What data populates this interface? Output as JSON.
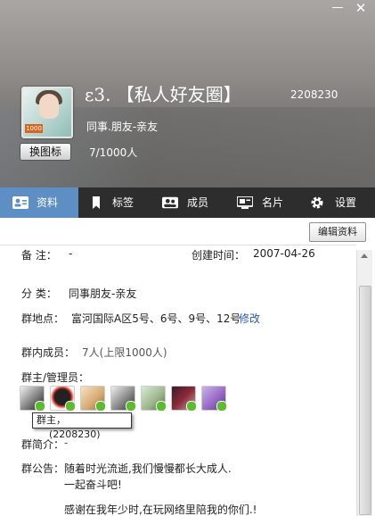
{
  "window": {
    "min_glyph": "—",
    "close_glyph": "✕"
  },
  "group": {
    "name": "ε3. 【私人好友圈】",
    "id": "2208230",
    "category": "同事.朋友-亲友",
    "member_count": "7/1000人",
    "avatar_badge": "1000",
    "change_icon_label": "换图标"
  },
  "tabs": [
    {
      "label": "资料",
      "icon": "id-card-icon"
    },
    {
      "label": "标签",
      "icon": "bookmark-icon"
    },
    {
      "label": "成员",
      "icon": "members-icon"
    },
    {
      "label": "名片",
      "icon": "business-card-icon"
    },
    {
      "label": "设置",
      "icon": "gear-icon"
    }
  ],
  "profile": {
    "edit_label": "编辑资料",
    "remark_label": "备  注：",
    "remark_value": "-",
    "created_label": "创建时间：",
    "created_value": "2007-04-26",
    "category_label": "分  类：",
    "category_value": "同事朋友-亲友",
    "location_label": "群地点：",
    "location_value": "富河国际A区5号、6号、9号、12号",
    "location_edit": "修改",
    "members_label": "群内成员：",
    "members_value": "7人(上限1000人)",
    "admins_label": "群主/管理员：",
    "tooltip_role": "群主，",
    "tooltip_id": "(2208230)",
    "intro_label": "群简介：",
    "intro_value": "-",
    "notice_label": "群公告：",
    "notice_lines": [
      "随着时光流逝,我们慢慢都长大成人.",
      "一起奋斗吧!",
      "感谢在我年少时,在玩网络里陪我的你们.!"
    ]
  },
  "colors": {
    "tab_active": "#5d8ec4",
    "tab_bar": "#2d2d2d",
    "link": "#2a5bb0",
    "online": "#5dbb2f"
  },
  "admins": [
    {
      "name": "admin-avatar-1"
    },
    {
      "name": "admin-avatar-2"
    },
    {
      "name": "admin-avatar-3"
    },
    {
      "name": "admin-avatar-4"
    },
    {
      "name": "admin-avatar-5"
    },
    {
      "name": "admin-avatar-6"
    },
    {
      "name": "admin-avatar-7"
    }
  ]
}
